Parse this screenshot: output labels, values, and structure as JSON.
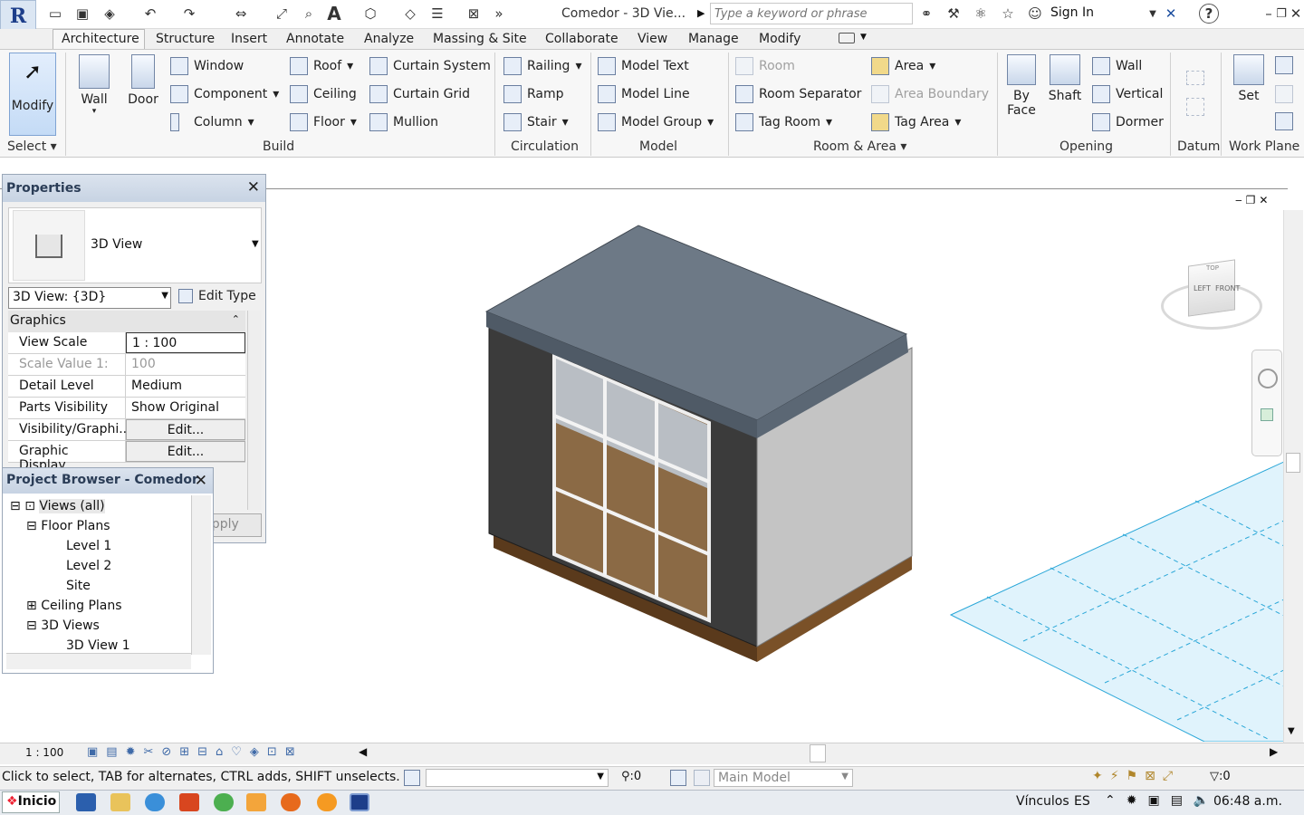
{
  "app": {
    "logo": "R",
    "title": "Comedor - 3D Vie...",
    "search_placeholder": "Type a keyword or phrase",
    "sign_in": "Sign In"
  },
  "tabs": [
    "Architecture",
    "Structure",
    "Insert",
    "Annotate",
    "Analyze",
    "Massing & Site",
    "Collaborate",
    "View",
    "Manage",
    "Modify"
  ],
  "ribbon": {
    "select": {
      "modify": "Modify",
      "label": "Select"
    },
    "build": {
      "wall": "Wall",
      "door": "Door",
      "window": "Window",
      "component": "Component",
      "column": "Column",
      "roof": "Roof",
      "ceiling": "Ceiling",
      "floor": "Floor",
      "curtain_system": "Curtain  System",
      "curtain_grid": "Curtain  Grid",
      "mullion": "Mullion",
      "label": "Build"
    },
    "circulation": {
      "railing": "Railing",
      "ramp": "Ramp",
      "stair": "Stair",
      "label": "Circulation"
    },
    "model": {
      "model_text": "Model  Text",
      "model_line": "Model  Line",
      "model_group": "Model  Group",
      "label": "Model"
    },
    "room_area": {
      "room": "Room",
      "room_separator": "Room  Separator",
      "tag_room": "Tag  Room",
      "area": "Area",
      "area_boundary": "Area  Boundary",
      "tag_area": "Tag  Area",
      "label": "Room & Area"
    },
    "opening": {
      "by_face_1": "By",
      "by_face_2": "Face",
      "shaft": "Shaft",
      "wall": "Wall",
      "vertical": "Vertical",
      "dormer": "Dormer",
      "label": "Opening"
    },
    "datum": {
      "label": "Datum"
    },
    "work_plane": {
      "set": "Set",
      "label": "Work Plane"
    }
  },
  "properties": {
    "title": "Properties",
    "type_name": "3D View",
    "selector": "3D View: {3D}",
    "edit_type": "Edit Type",
    "section": "Graphics",
    "rows": [
      {
        "key": "View Scale",
        "value": "1 : 100"
      },
      {
        "key": "Scale Value    1:",
        "value": "100"
      },
      {
        "key": "Detail Level",
        "value": "Medium"
      },
      {
        "key": "Parts Visibility",
        "value": "Show Original"
      },
      {
        "key": "Visibility/Graphi...",
        "value": "Edit..."
      },
      {
        "key": "Graphic Display...",
        "value": "Edit..."
      }
    ],
    "apply": "Apply"
  },
  "project_browser": {
    "title": "Project Browser - Comedor",
    "items": [
      "Views (all)",
      "Floor Plans",
      "Level 1",
      "Level 2",
      "Site",
      "Ceiling Plans",
      "3D Views",
      "3D View 1"
    ]
  },
  "viewcube": {
    "left": "LEFT",
    "front": "FRONT",
    "top": "TOP"
  },
  "view_bar": {
    "scale": "1 : 100"
  },
  "status": {
    "hint": "Click to select, TAB for alternates, CTRL adds, SHIFT unselects.",
    "worksets": ":0",
    "model": "Main Model",
    "filter": ":0"
  },
  "taskbar": {
    "start": "Inicio",
    "links": "Vínculos",
    "lang": "ES",
    "time": "06:48 a.m."
  }
}
